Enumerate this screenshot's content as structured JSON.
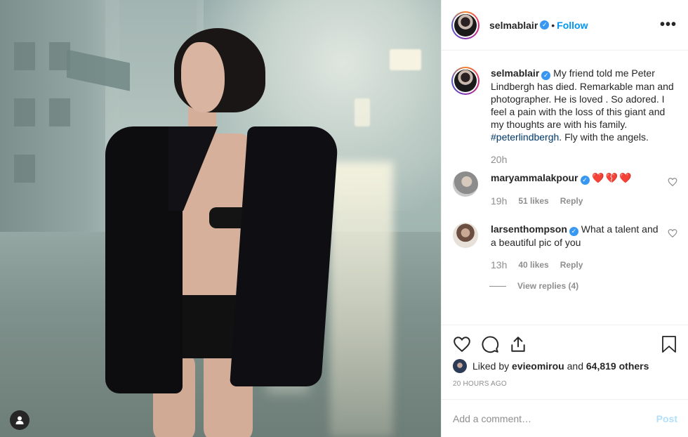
{
  "header": {
    "username": "selmablair",
    "separator": "•",
    "follow_label": "Follow",
    "more_label": "•••"
  },
  "caption": {
    "username": "selmablair",
    "text_before_tag": "My friend told me Peter Lindbergh has died. Remarkable man and photographer. He is loved . So adored. I feel a pain with the loss of this giant and my thoughts are with his family. ",
    "hashtag": "#peterlindbergh",
    "text_after_tag": ". Fly with the angels.",
    "time": "20h"
  },
  "comments": [
    {
      "username": "maryammalakpour",
      "text": "❤️💔❤️",
      "time": "19h",
      "likes": "51 likes",
      "reply_label": "Reply"
    },
    {
      "username": "larsenthompson",
      "text": "What a talent and a beautiful pic of you",
      "time": "13h",
      "likes": "40 likes",
      "reply_label": "Reply",
      "view_replies": "View replies (4)"
    }
  ],
  "likes": {
    "prefix": "Liked by ",
    "user": "evieomirou",
    "middle": " and ",
    "others": "64,819 others"
  },
  "posted_ago": "20 HOURS AGO",
  "add_comment": {
    "placeholder": "Add a comment…",
    "post_label": "Post"
  },
  "colors": {
    "accent": "#0095f6",
    "verified": "#3897f0",
    "heart_emoji": "#d1002b",
    "post_disabled": "#b2dffc"
  },
  "icons": [
    "heart-icon",
    "comment-icon",
    "share-icon",
    "bookmark-icon",
    "user-icon",
    "verified-badge-icon",
    "more-options-icon"
  ]
}
